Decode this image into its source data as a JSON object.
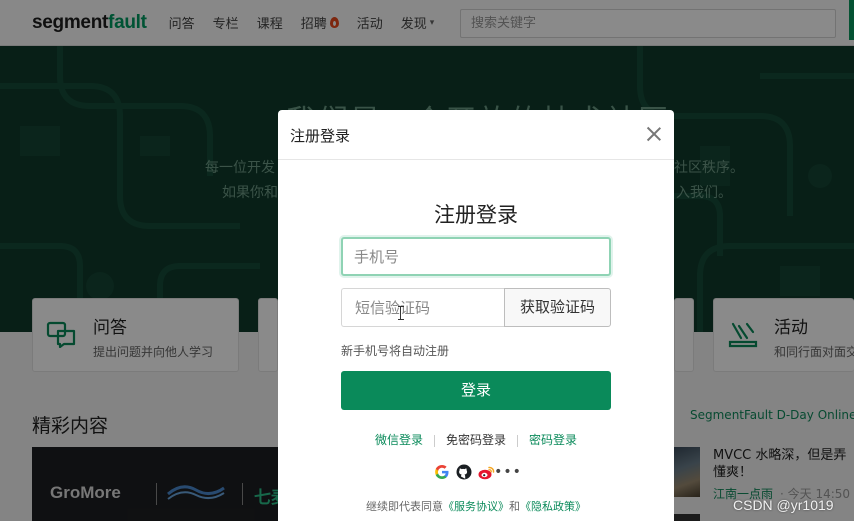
{
  "nav": {
    "logo_main": "segment",
    "logo_accent": "fault",
    "items": [
      {
        "label": "问答"
      },
      {
        "label": "专栏"
      },
      {
        "label": "课程"
      },
      {
        "label": "招聘"
      },
      {
        "label": "活动"
      },
      {
        "label": "发现"
      }
    ],
    "search_placeholder": "搜索关键字"
  },
  "hero": {
    "title": "我们是一个开放的技术社区",
    "subtitle_1": "每一位开发",
    "subtitle_2": "如果你和",
    "subtitle_1_right": "社区秩序。",
    "subtitle_2_right": "入我们。"
  },
  "cards": {
    "qa_title": "问答",
    "qa_desc": "提出问题并向他人学习",
    "activity_title": "活动",
    "activity_desc": "和同行面对面交"
  },
  "content": {
    "section_title": "精彩内容",
    "banner_text": "GroMore",
    "banner_cn": "七麦数",
    "dday": "SegmentFault D-Day Online 论",
    "news_title": "MVCC 水略深，但是弄懂爽！",
    "news_author": "江南一点雨",
    "news_time": "· 今天 14:50"
  },
  "modal": {
    "title": "注册登录",
    "heading": "注册登录",
    "phone_placeholder": "手机号",
    "code_placeholder": "短信验证码",
    "get_code": "获取验证码",
    "hint": "新手机号将自动注册",
    "login": "登录",
    "wechat_login": "微信登录",
    "no_password_login": "免密码登录",
    "password_login": "密码登录",
    "agreement_prefix": "继续即代表同意",
    "service_agreement": "《服务协议》",
    "and": "和",
    "privacy_policy": "《隐私政策》"
  },
  "watermark": "CSDN @yr1019",
  "colors": {
    "brand_green": "#019a61",
    "button_green": "#0a8a5a",
    "hero_bg": "#0f3a2b"
  },
  "icons": [
    "fire-icon",
    "close-icon",
    "google-icon",
    "github-icon",
    "weibo-icon",
    "more-icon",
    "qa-icon",
    "activity-icon",
    "caret-down-icon"
  ]
}
